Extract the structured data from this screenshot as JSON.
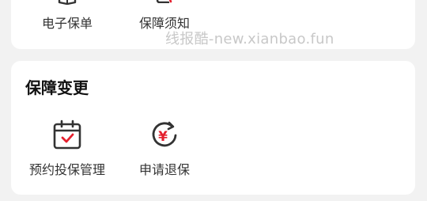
{
  "top_section": {
    "items": [
      {
        "label": "电子保单",
        "icon": "document-icon"
      },
      {
        "label": "保障须知",
        "icon": "notice-icon"
      }
    ]
  },
  "change_section": {
    "title": "保障变更",
    "items": [
      {
        "label": "预约投保管理",
        "icon": "calendar-check-icon"
      },
      {
        "label": "申请退保",
        "icon": "yuan-refund-icon"
      }
    ]
  },
  "watermark": "线报酷-new.xianbao.fun",
  "colors": {
    "accent": "#e4202e",
    "icon_dark": "#333333",
    "background": "#f2f2f2",
    "card": "#ffffff"
  }
}
